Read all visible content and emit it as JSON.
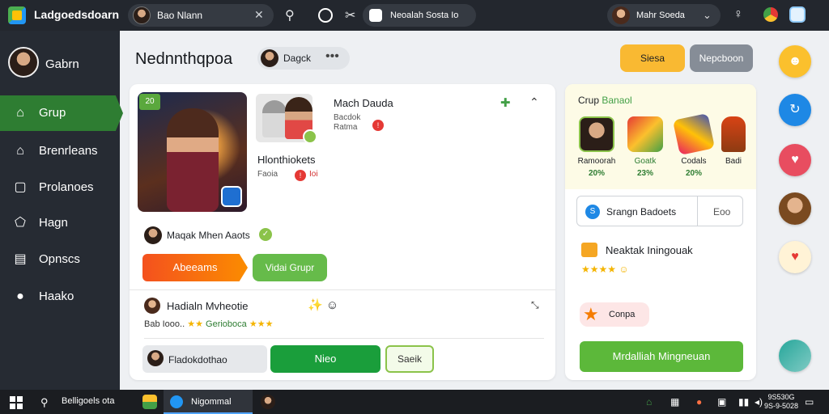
{
  "topbar": {
    "app_title": "Ladgoedsdoarn",
    "search_value": "Bao Nlann",
    "tab_label": "Neoalah Sosta Io",
    "user_name": "Mahr Soeda"
  },
  "sidebar": {
    "profile_name": "Gabrn",
    "items": [
      {
        "label": "Grup",
        "icon": "home-icon",
        "active": true
      },
      {
        "label": "Brenrleans",
        "icon": "house-icon",
        "active": false
      },
      {
        "label": "Prolanoes",
        "icon": "panel-icon",
        "active": false
      },
      {
        "label": "Hagn",
        "icon": "tag-icon",
        "active": false
      },
      {
        "label": "Opnscs",
        "icon": "list-icon",
        "active": false
      },
      {
        "label": "Haako",
        "icon": "chat-icon",
        "active": false
      }
    ]
  },
  "header": {
    "title": "Nednnthqpoa",
    "chip_label": "Dagck",
    "btn_primary": "Siesa",
    "btn_secondary": "Nepcboon"
  },
  "main_card": {
    "art_badge": "20",
    "entry1_title": "Mach Dauda",
    "entry1_sub1": "Bacdok",
    "entry1_sub2": "Ratma",
    "entry2_title": "Hlonthiokets",
    "entry2_sub": "Faoia",
    "entry2_badge_text": "Ioi",
    "host_text": "Maqak Mhen Aaots",
    "btn_arrow": "Abeeams",
    "btn_green_small": "Vidai Grupr",
    "review_name": "Hadialn Mvheotie",
    "review_meta_a": "Bab Iooo..",
    "review_meta_b": "Gerioboca",
    "review_stars_a": "★★",
    "review_stars_b": "★★★",
    "input_label": "Fladokdothao",
    "btn_green": "Nieo",
    "btn_outline": "Saeik"
  },
  "right_panel": {
    "group_title_a": "Crup",
    "group_title_b": "Banaol",
    "group_items": [
      {
        "name": "Ramoorah",
        "pct": "20%"
      },
      {
        "name": "Goatk",
        "pct": "23%"
      },
      {
        "name": "Codals",
        "pct": "20%"
      },
      {
        "name": "Badi",
        "pct": ""
      }
    ],
    "select_value": "Srangn Badoets",
    "select_alt": "Eoo",
    "reward_title": "Neaktak Iningouak",
    "reward_stars": "★★★★",
    "chip_label": "Conpa",
    "btn_wide": "Mrdalliah Mingneuan"
  },
  "taskbar": {
    "search_text": "Belligoels ota",
    "active_app": "Nigommal",
    "clock_time": "9S530G",
    "clock_date": "9S-9-5028"
  },
  "colors": {
    "sidebar_active": "#2e7d32",
    "accent_orange": "#f9b932",
    "accent_green": "#1a9e3b"
  }
}
